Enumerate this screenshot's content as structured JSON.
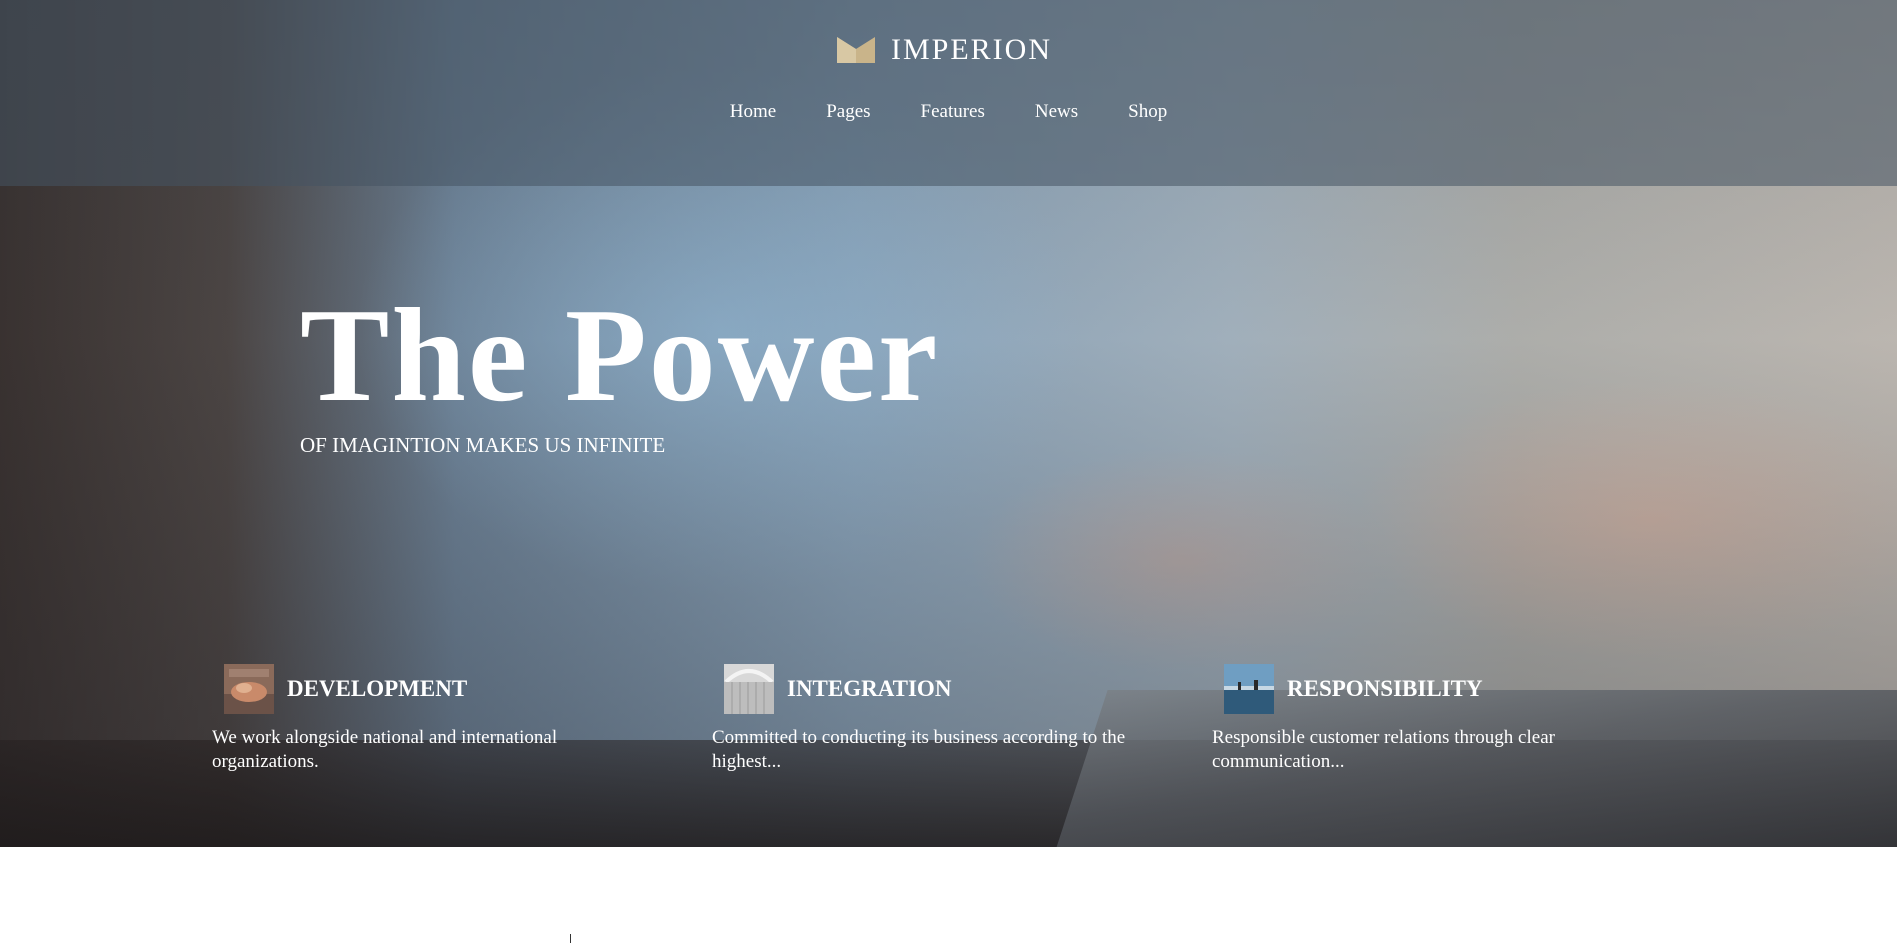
{
  "brand": {
    "name": "IMPERION",
    "logo_icon": "crown-logo-icon",
    "logo_color": "#c9b48a"
  },
  "nav": {
    "items": [
      {
        "label": "Home"
      },
      {
        "label": "Pages"
      },
      {
        "label": "Features"
      },
      {
        "label": "News"
      },
      {
        "label": "Shop"
      }
    ]
  },
  "hero": {
    "headline": "The Power",
    "subline": "OF IMAGINTION MAKES US INFINITE"
  },
  "features": [
    {
      "title": "DEVELOPMENT",
      "description": "We work alongside national and international organizations.",
      "thumb_icon": "development-thumbnail"
    },
    {
      "title": "INTEGRATION",
      "description": "Committed to conducting its business according to the highest...",
      "thumb_icon": "integration-thumbnail"
    },
    {
      "title": "RESPONSIBILITY",
      "description": "Responsible customer relations through clear communication...",
      "thumb_icon": "responsibility-thumbnail"
    }
  ]
}
